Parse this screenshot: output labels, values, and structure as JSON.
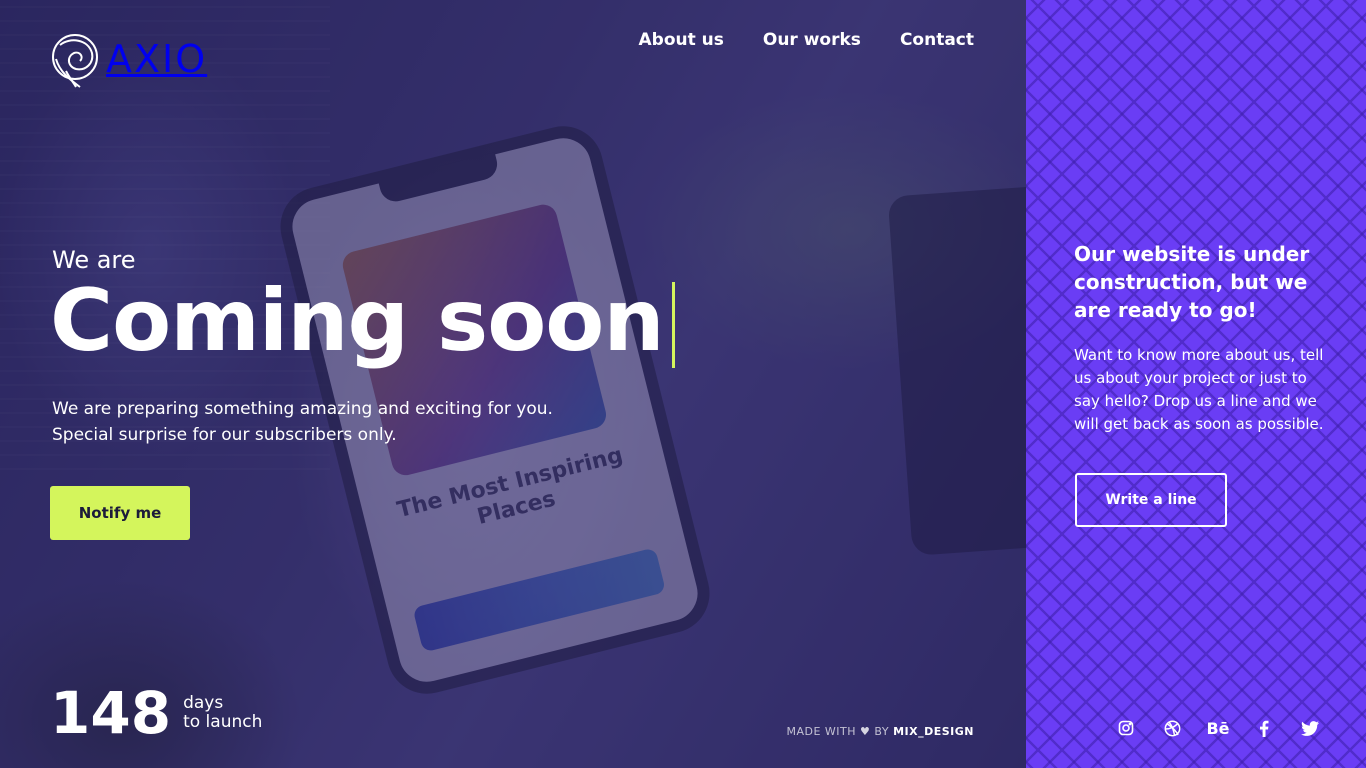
{
  "brand": {
    "name": "AXIO"
  },
  "nav": [
    {
      "label": "About us"
    },
    {
      "label": "Our works"
    },
    {
      "label": "Contact"
    }
  ],
  "hero": {
    "intro": "We are",
    "title": "Coming soon",
    "subtitle_line1": "We are preparing something amazing and exciting for you.",
    "subtitle_line2": "Special surprise for our subscribers only.",
    "cta_label": "Notify me",
    "cta_color": "#d4f55c"
  },
  "background_phone": {
    "headline": "The Most Inspiring Places"
  },
  "countdown": {
    "number": "148",
    "unit": "days",
    "suffix": "to launch"
  },
  "credit": {
    "prefix": "MADE WITH",
    "by": "BY",
    "author": "MIX_DESIGN"
  },
  "panel": {
    "accent": "#6a3df5",
    "heading": "Our website is under construction, but we are ready to go!",
    "body": "Want to know more about us, tell us about your project or just to say hello? Drop us a line and we will get back as soon as possible.",
    "button_label": "Write a line"
  },
  "social": [
    {
      "icon": "instagram-icon"
    },
    {
      "icon": "dribbble-icon"
    },
    {
      "icon": "behance-icon",
      "label": "Bē"
    },
    {
      "icon": "facebook-icon"
    },
    {
      "icon": "twitter-icon"
    }
  ]
}
